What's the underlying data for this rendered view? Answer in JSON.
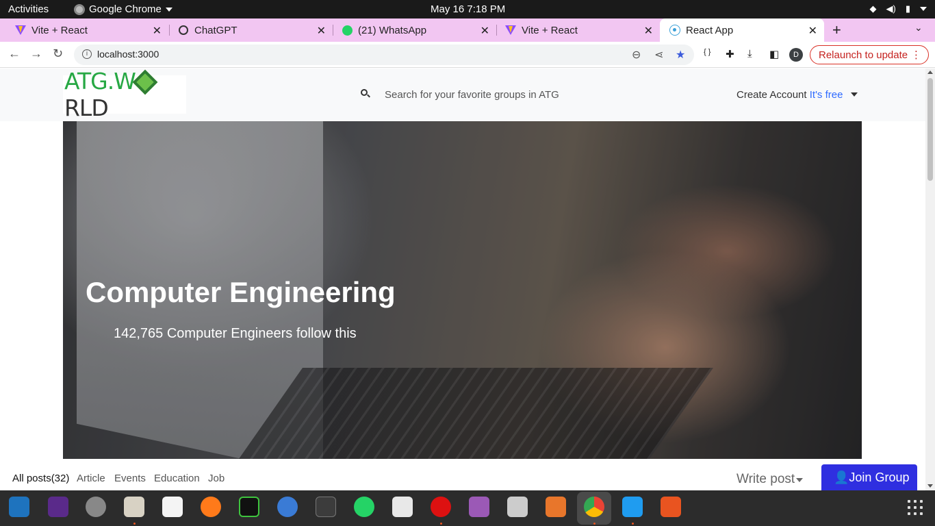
{
  "system_bar": {
    "activities": "Activities",
    "app_name": "Google Chrome",
    "clock": "May 16  7:18 PM"
  },
  "browser": {
    "tabs": [
      {
        "title": "Vite + React",
        "icon": "vite-icon"
      },
      {
        "title": "ChatGPT",
        "icon": "chatgpt-icon"
      },
      {
        "title": "(21) WhatsApp",
        "icon": "whatsapp-icon"
      },
      {
        "title": "Vite + React",
        "icon": "vite-icon"
      },
      {
        "title": "React App",
        "icon": "react-icon",
        "active": true
      }
    ],
    "close_glyph": "✕",
    "new_tab_glyph": "+",
    "url": "localhost:3000",
    "relaunch_label": "Relaunch to update",
    "profile_initial": "D",
    "accent": "#f2c6f2"
  },
  "site": {
    "logo": {
      "part1": "ATG.W",
      "part2": "RLD"
    },
    "search_placeholder": "Search for your favorite groups in ATG",
    "create_account": "Create Account",
    "its_free": "It's free"
  },
  "hero": {
    "title": "Computer Engineering",
    "subtitle": "142,765 Computer Engineers follow this"
  },
  "post_tabs": [
    {
      "label": "All posts(32)",
      "active": true
    },
    {
      "label": "Article"
    },
    {
      "label": "Events"
    },
    {
      "label": "Education"
    },
    {
      "label": "Job"
    }
  ],
  "actions": {
    "write_post": "Write post",
    "join_group": "Join Group"
  },
  "colors": {
    "join_button": "#2f2fe0",
    "its_free": "#2f6bff",
    "logo_green": "#27a844"
  }
}
